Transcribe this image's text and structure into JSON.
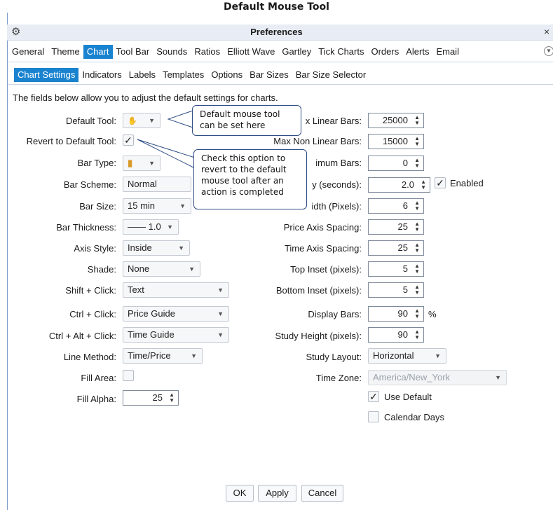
{
  "caption": "Default Mouse Tool",
  "window": {
    "title": "Preferences",
    "close_glyph": "×",
    "settings_icon": "gear-icon"
  },
  "top_tabs": [
    "General",
    "Theme",
    "Chart",
    "Tool Bar",
    "Sounds",
    "Ratios",
    "Elliott Wave",
    "Gartley",
    "Tick Charts",
    "Orders",
    "Alerts",
    "Email"
  ],
  "top_tabs_active": "Chart",
  "sub_tabs": [
    "Chart Settings",
    "Indicators",
    "Labels",
    "Templates",
    "Options",
    "Bar Sizes",
    "Bar Size Selector"
  ],
  "sub_tabs_active": "Chart Settings",
  "description": "The fields below allow you to adjust the default settings for charts.",
  "left": {
    "default_tool": {
      "label": "Default Tool:",
      "icon": "hand-icon"
    },
    "revert_default_tool": {
      "label": "Revert to Default Tool:",
      "checked": true
    },
    "bar_type": {
      "label": "Bar Type:",
      "icon": "candle-icon"
    },
    "bar_scheme": {
      "label": "Bar Scheme:",
      "value": "Normal"
    },
    "bar_size": {
      "label": "Bar Size:",
      "value": "15 min"
    },
    "bar_thickness": {
      "label": "Bar Thickness:",
      "value": "1.0"
    },
    "axis_style": {
      "label": "Axis Style:",
      "value": "Inside"
    },
    "shade": {
      "label": "Shade:",
      "value": "None"
    },
    "shift_click": {
      "label": "Shift + Click:",
      "value": "Text"
    },
    "ctrl_click": {
      "label": "Ctrl + Click:",
      "value": "Price Guide"
    },
    "ctrl_alt_click": {
      "label": "Ctrl + Alt + Click:",
      "value": "Time Guide"
    },
    "line_method": {
      "label": "Line Method:",
      "value": "Time/Price"
    },
    "fill_area": {
      "label": "Fill Area:",
      "checked": false
    },
    "fill_alpha": {
      "label": "Fill Alpha:",
      "value": "25"
    }
  },
  "right": {
    "max_linear_bars": {
      "label": "x Linear Bars:",
      "value": "25000"
    },
    "max_non_linear_bars": {
      "label": "Max Non Linear Bars:",
      "value": "15000"
    },
    "minimum_bars": {
      "label": "imum Bars:",
      "value": "0"
    },
    "delay": {
      "label": "y (seconds):",
      "value": "2.0",
      "enabled_label": "Enabled",
      "enabled": true
    },
    "width": {
      "label": "idth (Pixels):",
      "value": "6"
    },
    "price_axis_spacing": {
      "label": "Price Axis Spacing:",
      "value": "25"
    },
    "time_axis_spacing": {
      "label": "Time Axis Spacing:",
      "value": "25"
    },
    "top_inset": {
      "label": "Top Inset (pixels):",
      "value": "5"
    },
    "bottom_inset": {
      "label": "Bottom Inset (pixels):",
      "value": "5"
    },
    "display_bars": {
      "label": "Display Bars:",
      "value": "90",
      "unit": "%"
    },
    "study_height": {
      "label": "Study Height (pixels):",
      "value": "90"
    },
    "study_layout": {
      "label": "Study Layout:",
      "value": "Horizontal"
    },
    "time_zone": {
      "label": "Time Zone:",
      "value": "America/New_York"
    },
    "use_default": {
      "label": "Use Default",
      "checked": true
    },
    "calendar_days": {
      "label": "Calendar Days",
      "checked": false
    }
  },
  "callouts": {
    "default_tool": "Default mouse tool can be set here",
    "revert": "Check this option to revert to the default mouse tool after an action is completed"
  },
  "buttons": {
    "ok": "OK",
    "apply": "Apply",
    "cancel": "Cancel"
  },
  "colors": {
    "accent": "#1a83d0",
    "callout_border": "#2f4d86"
  }
}
